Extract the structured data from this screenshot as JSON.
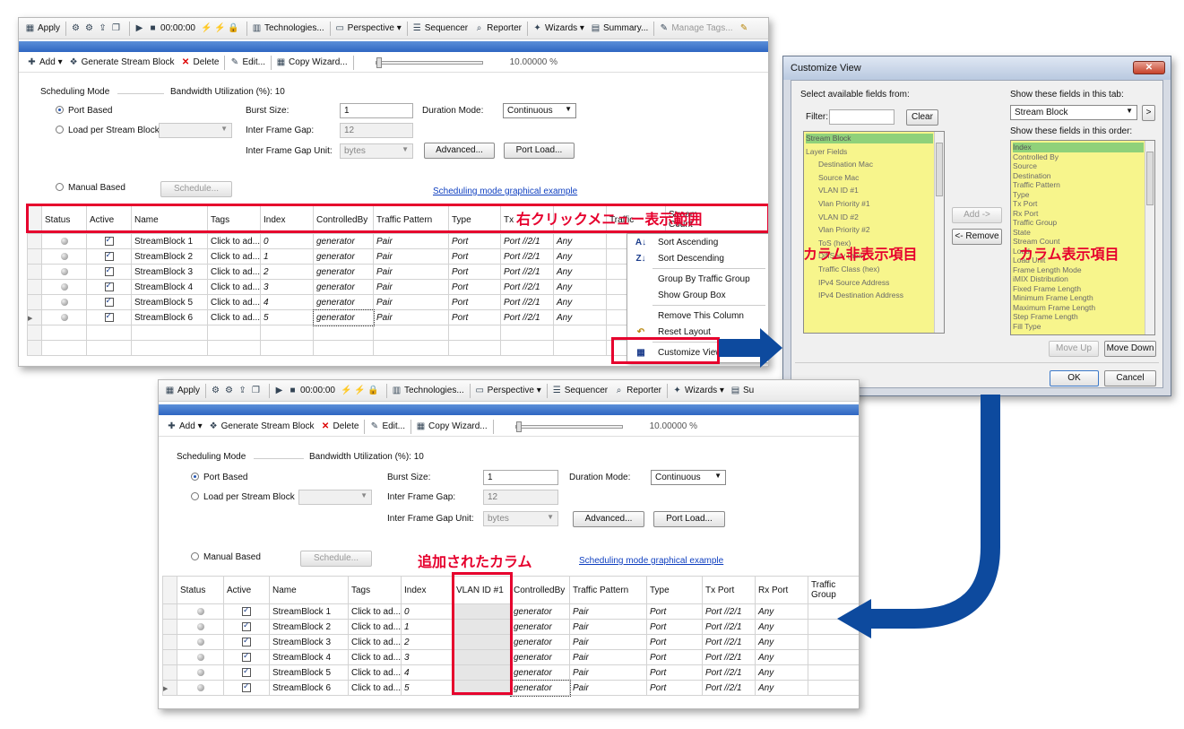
{
  "toolbar_top": {
    "apply": "Apply",
    "timer": "00:00:00",
    "technologies": "Technologies...",
    "perspective": "Perspective",
    "sequencer": "Sequencer",
    "reporter": "Reporter",
    "wizards": "Wizards",
    "summary": "Summary...",
    "summary_short": "Su",
    "manage_tags": "Manage Tags..."
  },
  "subtoolbar": {
    "add": "Add",
    "generate": "Generate Stream Block",
    "delete": "Delete",
    "edit": "Edit...",
    "copy_wizard": "Copy Wizard...",
    "zoom": "10.00000 %"
  },
  "scheduling": {
    "mode_label": "Scheduling Mode",
    "bandwidth": "Bandwidth Utilization (%): 10",
    "port_based": "Port Based",
    "load_per_stream": "Load per Stream Block",
    "manual_based": "Manual Based",
    "schedule_btn": "Schedule...",
    "burst_size_label": "Burst Size:",
    "burst_size": "1",
    "ifg_label": "Inter Frame Gap:",
    "ifg": "12",
    "ifg_unit_label": "Inter Frame Gap Unit:",
    "ifg_unit": "bytes",
    "duration_label": "Duration Mode:",
    "duration": "Continuous",
    "advanced_btn": "Advanced...",
    "port_load_btn": "Port Load...",
    "graphical_link": "Scheduling mode graphical example"
  },
  "grid1": {
    "headers": [
      "Status",
      "Active",
      "Name",
      "Tags",
      "Index",
      "Controlled By",
      "Traffic Pattern",
      "Type",
      "Tx Port",
      "Rx Port",
      "Traffic Group",
      "Stream Count"
    ],
    "visible_headers": [
      "Status",
      "Active",
      "Name",
      "Tags",
      "Index",
      "ControlledBy",
      "Traffic Pattern",
      "Type",
      "Tx",
      "",
      "Traffic",
      "Stream"
    ],
    "header_line2": [
      "",
      "",
      "",
      "",
      "",
      "",
      "",
      "",
      "",
      "",
      "",
      "Count"
    ]
  },
  "grid2": {
    "headers": [
      "Status",
      "Active",
      "Name",
      "Tags",
      "Index",
      "VLAN ID #1",
      "ControlledBy",
      "Traffic Pattern",
      "Type",
      "Tx Port",
      "Rx Port",
      "Traffic Group"
    ]
  },
  "rows": [
    {
      "name": "StreamBlock 1",
      "tags": "Click to ad...",
      "index": "0",
      "controlled": "generator",
      "pattern": "Pair",
      "type": "Port",
      "tx": "Port //2/1",
      "rx": "Any"
    },
    {
      "name": "StreamBlock 2",
      "tags": "Click to ad...",
      "index": "1",
      "controlled": "generator",
      "pattern": "Pair",
      "type": "Port",
      "tx": "Port //2/1",
      "rx": "Any"
    },
    {
      "name": "StreamBlock 3",
      "tags": "Click to ad...",
      "index": "2",
      "controlled": "generator",
      "pattern": "Pair",
      "type": "Port",
      "tx": "Port //2/1",
      "rx": "Any"
    },
    {
      "name": "StreamBlock 4",
      "tags": "Click to ad...",
      "index": "3",
      "controlled": "generator",
      "pattern": "Pair",
      "type": "Port",
      "tx": "Port //2/1",
      "rx": "Any"
    },
    {
      "name": "StreamBlock 5",
      "tags": "Click to ad...",
      "index": "4",
      "controlled": "generator",
      "pattern": "Pair",
      "type": "Port",
      "tx": "Port //2/1",
      "rx": "Any"
    },
    {
      "name": "StreamBlock 6",
      "tags": "Click to ad...",
      "index": "5",
      "controlled": "generator",
      "pattern": "Pair",
      "type": "Port",
      "tx": "Port //2/1",
      "rx": "Any"
    }
  ],
  "context_menu": {
    "sort_asc": "Sort Ascending",
    "sort_desc": "Sort Descending",
    "group_by": "Group By Traffic Group",
    "show_group_box": "Show Group Box",
    "remove_column": "Remove This Column",
    "reset_layout": "Reset Layout",
    "customize_view": "Customize View..."
  },
  "annotations": {
    "right_click_range": "右クリックメニュー表示範囲",
    "hidden_columns": "カラム非表示項目",
    "shown_columns": "カラム表示項目",
    "added_column": "追加されたカラム"
  },
  "dialog": {
    "title": "Customize View",
    "select_from": "Select available fields from:",
    "filter_label": "Filter:",
    "clear_btn": "Clear",
    "show_in_tab": "Show these fields in this tab:",
    "tab_value": "Stream Block",
    "show_order": "Show these fields in this order:",
    "add_btn": "Add ->",
    "remove_btn": "<- Remove",
    "move_up_btn": "Move Up",
    "move_down_btn": "Move Down",
    "ok_btn": "OK",
    "cancel_btn": "Cancel",
    "available": [
      "Stream Block",
      "Layer Fields",
      "Destination Mac",
      "Source Mac",
      "VLAN ID #1",
      "Vlan Priority #1",
      "VLAN ID #2",
      "Vlan Priority #2",
      "ToS (hex)",
      "DiffServ (hex)",
      "Traffic Class (hex)",
      "IPv4 Source Address",
      "IPv4 Destination Address"
    ],
    "shown": [
      "Index",
      "Controlled By",
      "Source",
      "Destination",
      "Traffic Pattern",
      "Type",
      "Tx Port",
      "Rx Port",
      "Traffic Group",
      "State",
      "Stream Count",
      "Load",
      "Load Unit",
      "Frame Length Mode",
      "iMIX Distribution",
      "Fixed Frame Length",
      "Minimum Frame Length",
      "Maximum Frame Length",
      "Step Frame Length",
      "Fill Type"
    ]
  },
  "colors": {
    "annotation_red": "#e6002d",
    "header_band_blue": "#2f66c2",
    "highlight_yellow": "#f7f58c",
    "arrow_blue": "#0d4a9e"
  }
}
